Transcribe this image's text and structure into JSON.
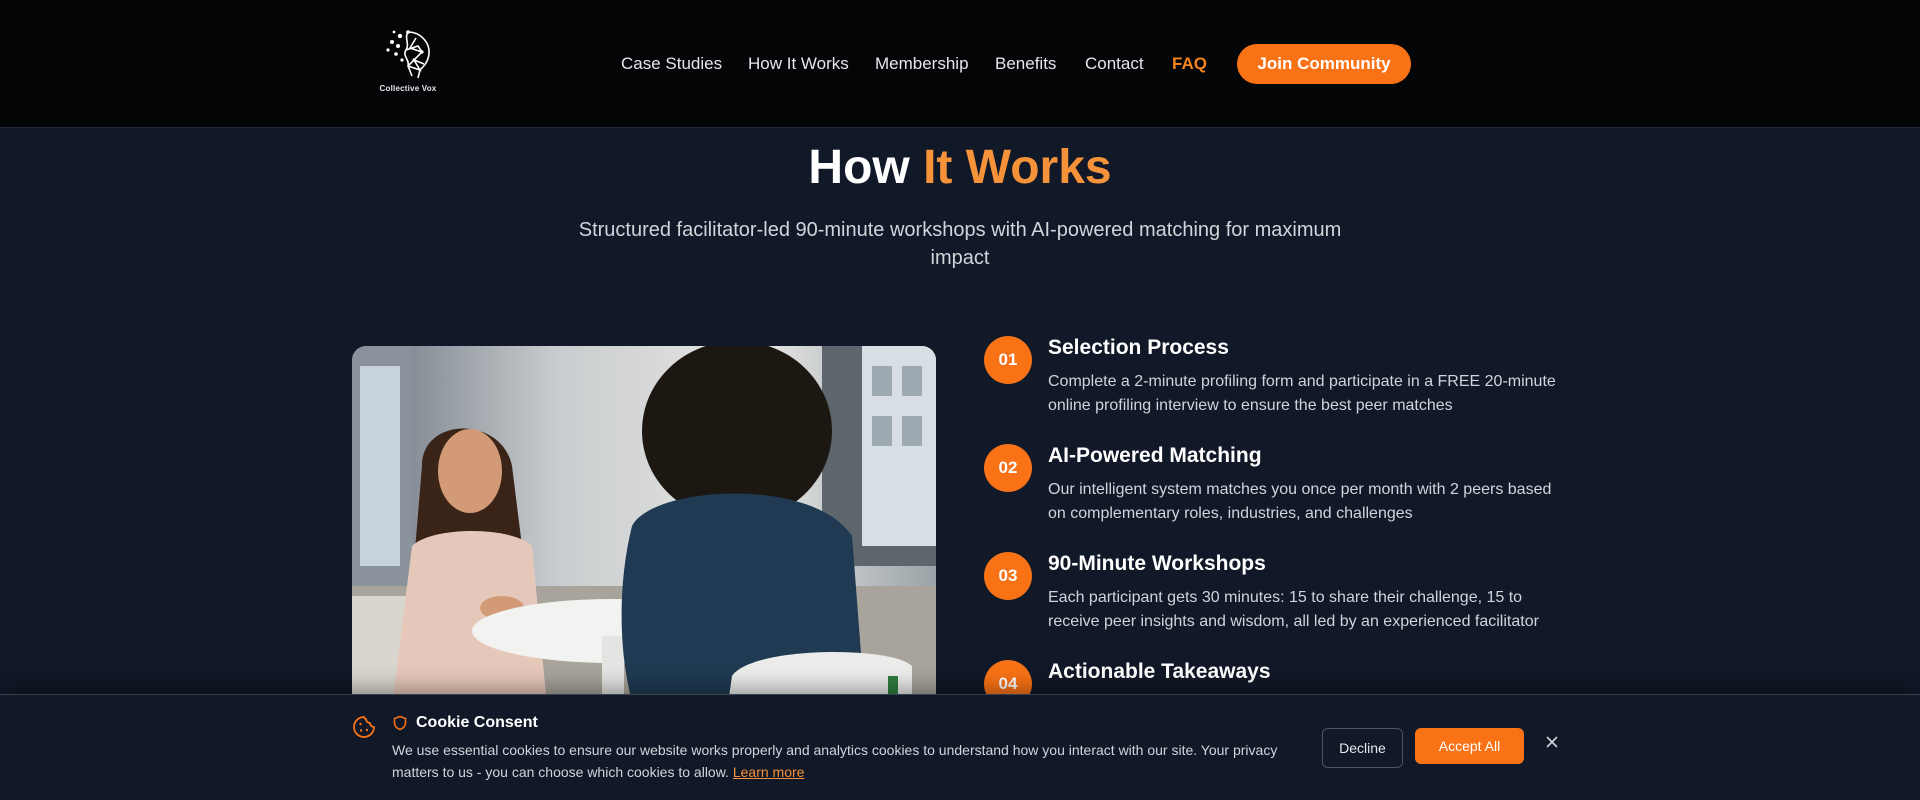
{
  "header": {
    "logo_text": "Collective Vox",
    "nav": [
      {
        "label": "Case Studies",
        "active": false
      },
      {
        "label": "How It Works",
        "active": false
      },
      {
        "label": "Membership",
        "active": false
      },
      {
        "label": "Benefits",
        "active": false
      },
      {
        "label": "Contact",
        "active": false
      },
      {
        "label": "FAQ",
        "active": true
      }
    ],
    "cta_label": "Join Community"
  },
  "hero": {
    "title_part1": "How",
    "title_accent": "It Works",
    "subtitle": "Structured facilitator-led 90-minute workshops with AI-powered matching for maximum impact"
  },
  "steps": [
    {
      "number": "01",
      "title": "Selection Process",
      "description": "Complete a 2-minute profiling form and participate in a FREE 20-minute online profiling interview to ensure the best peer matches"
    },
    {
      "number": "02",
      "title": "AI-Powered Matching",
      "description": "Our intelligent system matches you once per month with 2 peers based on complementary roles, industries, and challenges"
    },
    {
      "number": "03",
      "title": "90-Minute Workshops",
      "description": "Each participant gets 30 minutes: 15 to share their challenge, 15 to receive peer insights and wisdom, all led by an experienced facilitator"
    },
    {
      "number": "04",
      "title": "Actionable Takeaways",
      "description": ""
    }
  ],
  "cookie": {
    "title": "Cookie Consent",
    "text": "We use essential cookies to ensure our website works properly and analytics cookies to understand how you interact with our site. Your privacy matters to us - you can choose which cookies to allow.",
    "link_label": "Learn more",
    "decline_label": "Decline",
    "accept_label": "Accept All"
  },
  "colors": {
    "accent": "#f97316",
    "background": "#111827",
    "header_background": "#030507"
  },
  "icons": {
    "logo": "brain-network-icon",
    "cookie": "cookie-icon",
    "shield": "shield-icon",
    "close": "close-icon"
  }
}
